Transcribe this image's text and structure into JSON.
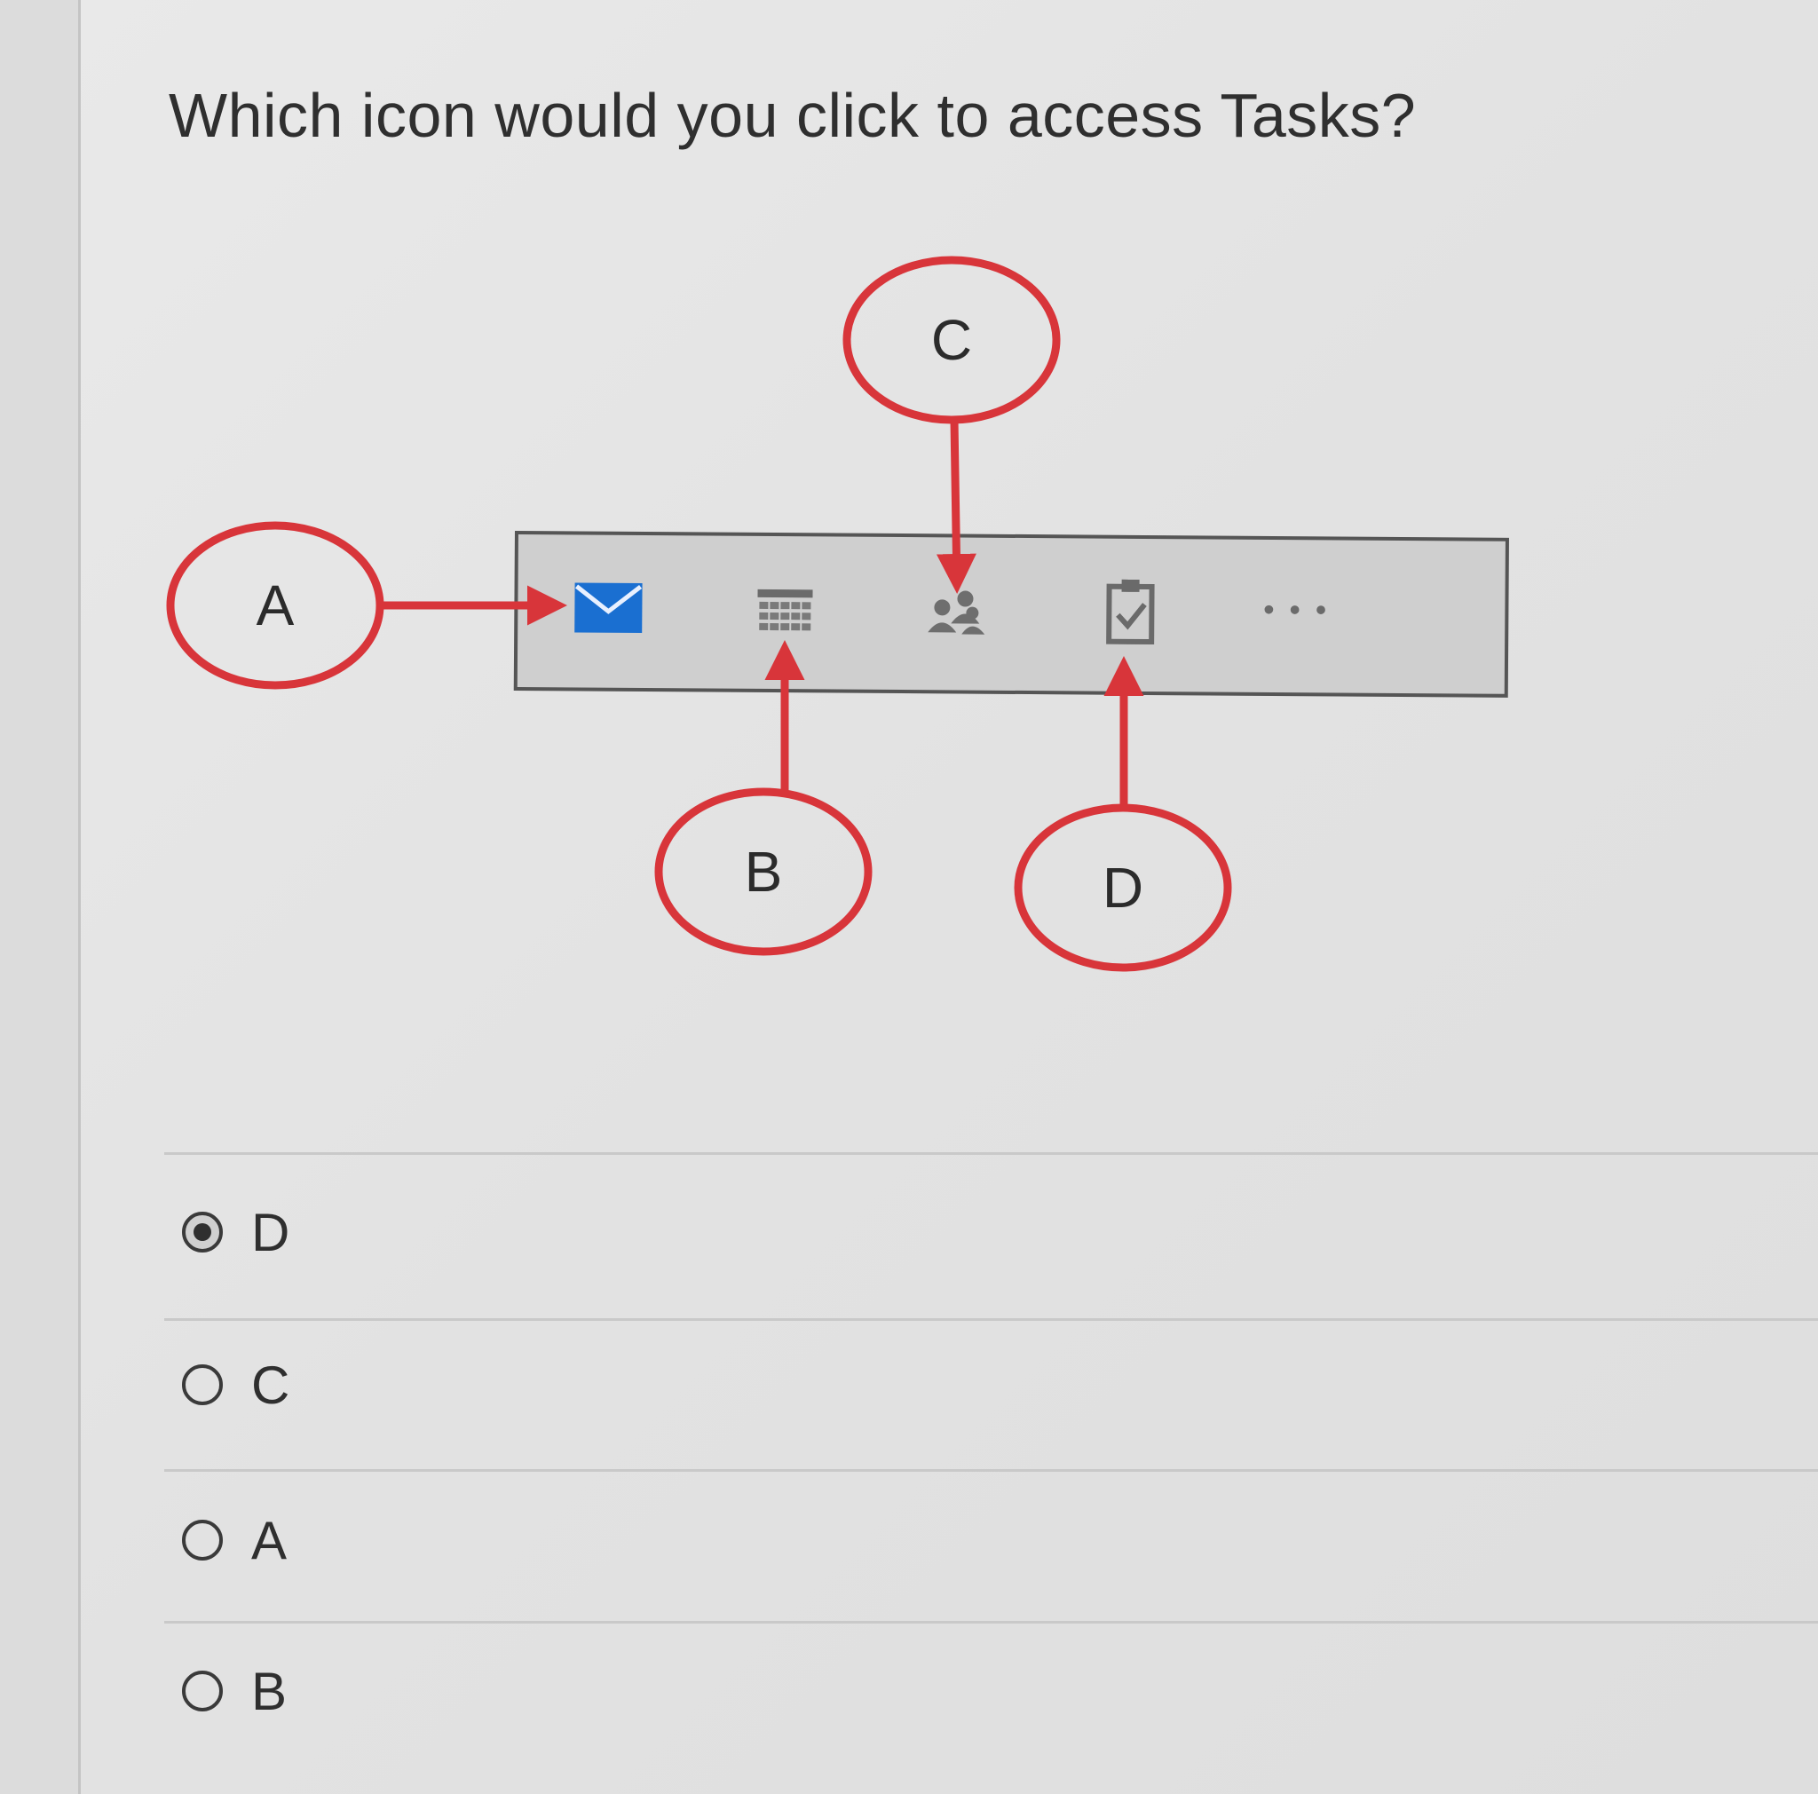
{
  "question": {
    "text": "Which icon would you click to access Tasks?"
  },
  "diagram": {
    "callouts": [
      {
        "id": "A",
        "label": "A",
        "target": "mail-icon"
      },
      {
        "id": "B",
        "label": "B",
        "target": "calendar-icon"
      },
      {
        "id": "C",
        "label": "C",
        "target": "people-icon"
      },
      {
        "id": "D",
        "label": "D",
        "target": "tasks-icon"
      }
    ],
    "toolbar_icons": [
      "mail-icon",
      "calendar-icon",
      "people-icon",
      "tasks-icon",
      "more-icon"
    ],
    "more_label": "• • •",
    "colors": {
      "callout_red": "#d8353a",
      "mail_blue": "#1a6fd1"
    }
  },
  "options": [
    {
      "label": "D",
      "selected": true
    },
    {
      "label": "C",
      "selected": false
    },
    {
      "label": "A",
      "selected": false
    },
    {
      "label": "B",
      "selected": false
    }
  ]
}
